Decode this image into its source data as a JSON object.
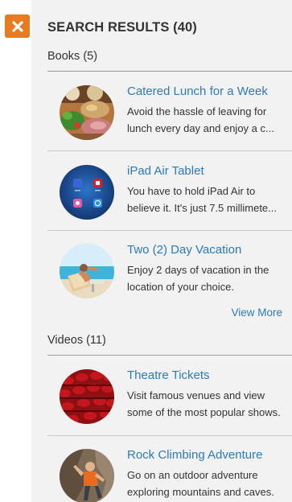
{
  "panel": {
    "title": "SEARCH RESULTS (40)",
    "close_icon": "close-x-icon",
    "accent_color": "#ea7a21",
    "link_color": "#2b7bbd"
  },
  "sections": [
    {
      "heading": "Books (5)",
      "items": [
        {
          "title": "Catered Lunch for a Week",
          "desc_line1": "Avoid the hassle of leaving for",
          "desc_line2": "lunch every day and enjoy a c..."
        },
        {
          "title": "iPad Air Tablet",
          "desc_line1": "You have to hold iPad Air to",
          "desc_line2": "believe it. It's just 7.5 millimete..."
        },
        {
          "title": "Two (2) Day Vacation",
          "desc_line1": "Enjoy 2 days of vacation in the",
          "desc_line2": "location of your choice."
        }
      ],
      "view_more": "View More"
    },
    {
      "heading": "Videos (11)",
      "items": [
        {
          "title": "Theatre Tickets",
          "desc_line1": "Visit famous venues and view",
          "desc_line2": "some of the most popular shows."
        },
        {
          "title": "Rock Climbing Adventure",
          "desc_line1": "Go on an outdoor adventure",
          "desc_line2": "exploring mountains and caves."
        }
      ]
    }
  ]
}
